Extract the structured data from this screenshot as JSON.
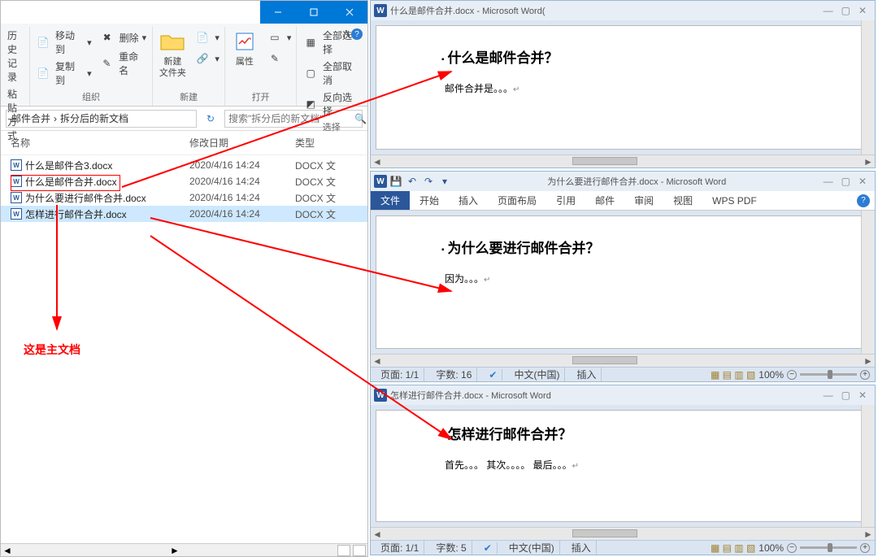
{
  "explorer": {
    "ribbon": {
      "history": "历史记录",
      "clip": "粘贴方式",
      "move": "移动到",
      "copy": "复制到",
      "delete": "删除",
      "rename": "重命名",
      "org_label": "组织",
      "new_folder": "新建\n文件夹",
      "new_label": "新建",
      "props": "属性",
      "open_label": "打开",
      "select_all": "全部选择",
      "select_none": "全部取消",
      "invert": "反向选择",
      "select_label": "选择"
    },
    "breadcrumb": {
      "p1": "邮件合并",
      "p2": "拆分后的新文档"
    },
    "search_placeholder": "搜索\"拆分后的新文档\"",
    "columns": {
      "name": "名称",
      "date": "修改日期",
      "type": "类型"
    },
    "files": [
      {
        "name": "什么是邮件合3.docx",
        "date": "2020/4/16 14:24",
        "type": "DOCX 文"
      },
      {
        "name": "什么是邮件合并.docx",
        "date": "2020/4/16 14:24",
        "type": "DOCX 文"
      },
      {
        "name": "为什么要进行邮件合并.docx",
        "date": "2020/4/16 14:24",
        "type": "DOCX 文"
      },
      {
        "name": "怎样进行邮件合并.docx",
        "date": "2020/4/16 14:24",
        "type": "DOCX 文"
      }
    ],
    "annotation": "这是主文档"
  },
  "word1": {
    "title": "什么是邮件合并.docx - Microsoft Word(",
    "heading": "什么是邮件合并？",
    "body": "邮件合并是。。。"
  },
  "word2": {
    "title": "为什么要进行邮件合并.docx - Microsoft Word",
    "tabs": {
      "file": "文件",
      "home": "开始",
      "insert": "插入",
      "layout": "页面布局",
      "ref": "引用",
      "mail": "邮件",
      "review": "审阅",
      "view": "视图",
      "wps": "WPS PDF"
    },
    "heading": "为什么要进行邮件合并？",
    "body": "因为。。。",
    "status": {
      "page": "页面: 1/1",
      "words": "字数: 16",
      "lang": "中文(中国)",
      "mode": "插入",
      "zoom": "100%"
    }
  },
  "word3": {
    "title": "怎样进行邮件合并.docx - Microsoft Word",
    "heading": "怎样进行邮件合并？",
    "body": "首先。。。  其次。。。。 最后。。。",
    "status": {
      "page": "页面: 1/1",
      "words": "字数: 5",
      "lang": "中文(中国)",
      "mode": "插入",
      "zoom": "100%"
    }
  }
}
